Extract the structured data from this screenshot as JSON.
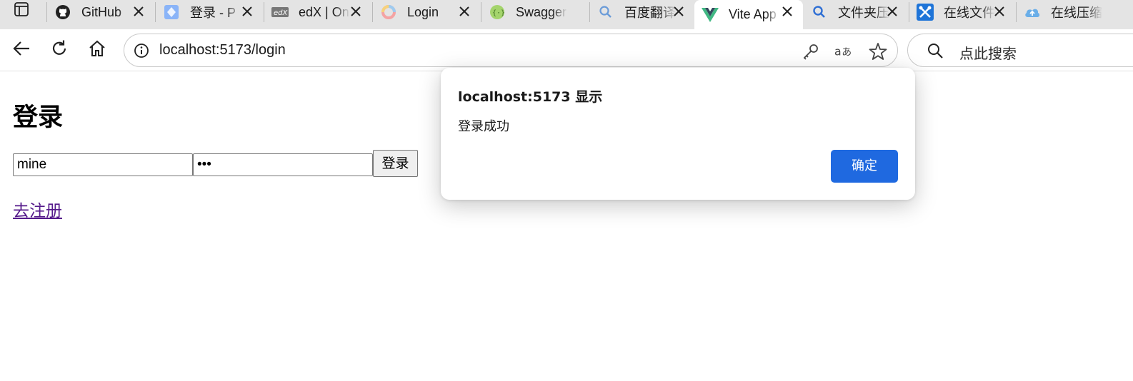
{
  "browser": {
    "tabs": [
      {
        "title": "GitHub",
        "icon": "github-icon"
      },
      {
        "title": "登录 - P",
        "icon": "diamond-icon"
      },
      {
        "title": "edX | On",
        "icon": "edx-icon"
      },
      {
        "title": "Login",
        "icon": "ring-logo-icon"
      },
      {
        "title": "Swagger",
        "icon": "swagger-icon"
      },
      {
        "title": "百度翻译",
        "icon": "search-icon"
      },
      {
        "title": "Vite App",
        "icon": "vue-icon",
        "active": true
      },
      {
        "title": "文件夹压",
        "icon": "search-icon"
      },
      {
        "title": "在线文件",
        "icon": "tools-icon"
      },
      {
        "title": "在线压缩",
        "icon": "cloud-icon"
      }
    ],
    "url": "localhost:5173/login",
    "search_placeholder": "点此搜索",
    "colors": {
      "tabstrip": "#e4e4e4",
      "accent": "#1f69e0",
      "link_visited": "#551a8b"
    }
  },
  "page": {
    "heading": "登录",
    "username_value": "mine",
    "password_value": "•••",
    "login_button": "登录",
    "register_link": "去注册"
  },
  "dialog": {
    "title": "localhost:5173 显示",
    "message": "登录成功",
    "ok_button": "确定"
  }
}
